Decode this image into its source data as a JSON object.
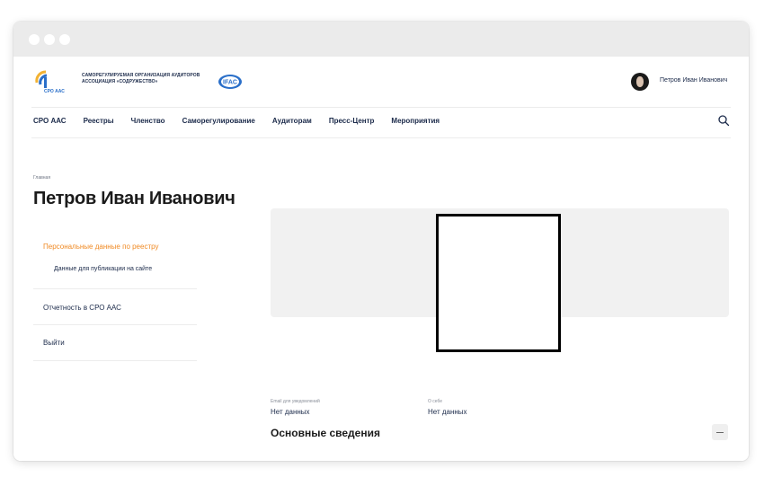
{
  "header": {
    "org_name": "Саморегулируемая организация аудиторов Ассоциация «Содружество»",
    "logo_text": "СРО ААС",
    "partner_logo_text": "IFAC",
    "user_name": "Петров Иван Иванович"
  },
  "nav": {
    "items": [
      {
        "label": "СРО ААС"
      },
      {
        "label": "Реестры"
      },
      {
        "label": "Членство"
      },
      {
        "label": "Саморегулирование"
      },
      {
        "label": "Аудиторам"
      },
      {
        "label": "Пресс-Центр"
      },
      {
        "label": "Мероприятия"
      }
    ]
  },
  "breadcrumb": "Главная",
  "page_title": "Петров Иван Иванович",
  "side_menu": {
    "active": "Персональные данные по реестру",
    "sub_item": "Данные для публикации на сайте",
    "items": [
      {
        "label": "Отчетность в СРО ААС"
      },
      {
        "label": "Выйти"
      }
    ]
  },
  "fields": {
    "email": {
      "label": "Email для уведомлений",
      "value": "Нет данных"
    },
    "about": {
      "label": "О себе",
      "value": "Нет данных"
    }
  },
  "section": {
    "title": "Основные сведения",
    "collapse_label": "—"
  },
  "colors": {
    "accent": "#f08a24",
    "text": "#1b2a4a",
    "brand_blue": "#2a6fc9",
    "brand_yellow": "#f2b233"
  }
}
